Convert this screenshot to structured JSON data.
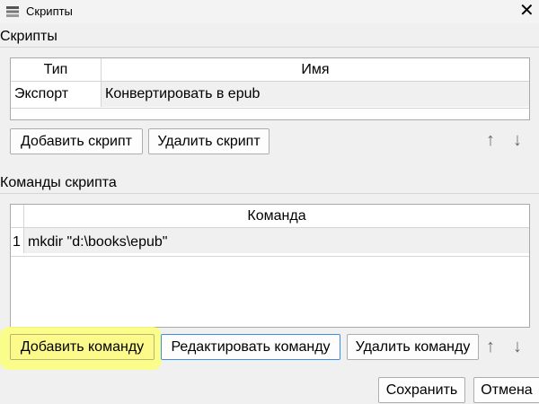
{
  "window": {
    "title": "Скрипты",
    "close_symbol": "✕"
  },
  "scripts_group": {
    "label": "Скрипты",
    "table": {
      "columns": [
        "Тип",
        "Имя"
      ],
      "rows": [
        {
          "type": "Экспорт",
          "name": "Конвертировать в epub"
        }
      ]
    },
    "buttons": {
      "add": "Добавить скрипт",
      "remove": "Удалить скрипт",
      "up": "↑",
      "down": "↓"
    }
  },
  "commands_group": {
    "label": "Команды скрипта",
    "table": {
      "column": "Команда",
      "rows": [
        {
          "index": "1",
          "command": "mkdir \"d:\\books\\epub\""
        }
      ]
    },
    "buttons": {
      "add": "Добавить команду",
      "edit": "Редактировать команду",
      "remove": "Удалить команду",
      "up": "↑",
      "down": "↓"
    }
  },
  "footer": {
    "save": "Сохранить",
    "cancel": "Отмена"
  },
  "highlight_color": "#fbff78"
}
